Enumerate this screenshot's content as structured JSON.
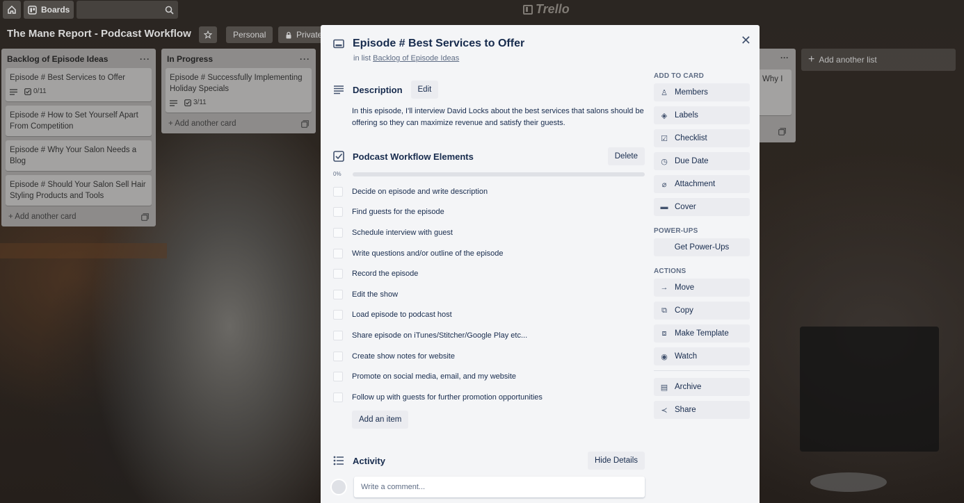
{
  "header": {
    "boards_label": "Boards",
    "logo_text": "Trello"
  },
  "board": {
    "title": "The Mane Report - Podcast Workflow",
    "visibility_team": "Personal",
    "visibility_private": "Private"
  },
  "lists": [
    {
      "title": "Backlog of Episode Ideas",
      "cards": [
        {
          "title": "Episode # Best Services to Offer",
          "checklist": "0/11"
        },
        {
          "title": "Episode # How to Set Yourself Apart From Competition"
        },
        {
          "title": "Episode # Why Your Salon Needs a Blog"
        },
        {
          "title": "Episode # Should Your Salon Sell Hair Styling Products and Tools"
        }
      ],
      "add_card": "Add another card"
    },
    {
      "title": "In Progress",
      "cards": [
        {
          "title": "Episode # Successfully Implementing Holiday Specials",
          "checklist": "3/11"
        }
      ],
      "add_card": "Add another card"
    }
  ],
  "hidden_list": {
    "card_text": "Why I"
  },
  "add_list_label": "Add another list",
  "modal": {
    "title": "Episode # Best Services to Offer",
    "in_list_prefix": "in list",
    "in_list_name": "Backlog of Episode Ideas",
    "description": {
      "heading": "Description",
      "edit_label": "Edit",
      "text": "In this episode, I'll interview David Locks about the best services that salons should be offering so they can maximize revenue and satisfy their guests."
    },
    "checklist": {
      "heading": "Podcast Workflow Elements",
      "delete_label": "Delete",
      "progress_label": "0%",
      "progress": 0,
      "items": [
        "Decide on episode and write description",
        "Find guests for the episode",
        "Schedule interview with guest",
        "Write questions and/or outline of the episode",
        "Record the episode",
        "Edit the show",
        "Load episode to podcast host",
        "Share episode on iTunes/Stitcher/Google Play etc...",
        "Create show notes for website",
        "Promote on social media, email, and my website",
        "Follow up with guests for further promotion opportunities"
      ],
      "add_item_label": "Add an item"
    },
    "activity": {
      "heading": "Activity",
      "hide_details_label": "Hide Details",
      "comment_placeholder": "Write a comment..."
    },
    "sidebar": {
      "add_to_card_heading": "ADD TO CARD",
      "add_to_card": [
        "Members",
        "Labels",
        "Checklist",
        "Due Date",
        "Attachment",
        "Cover"
      ],
      "power_ups_heading": "POWER-UPS",
      "get_power_ups": "Get Power-Ups",
      "actions_heading": "ACTIONS",
      "actions": [
        "Move",
        "Copy",
        "Make Template",
        "Watch"
      ],
      "archive": "Archive",
      "share": "Share"
    }
  }
}
